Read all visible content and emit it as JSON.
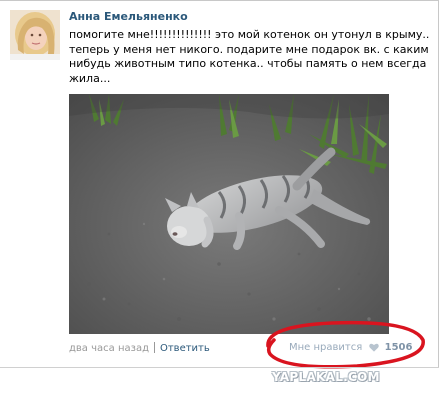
{
  "post": {
    "author": "Анна Емельяненко",
    "text_lines": [
      "помогите мне!!!!!!!!!!!!!! это мой котенок он утонул в крыму..",
      "теперь у меня нет никого. подарите мне подарок вк. с каким",
      "нибудь животным типо котенка.. чтобы память о нем всегда",
      "жила..."
    ],
    "timestamp": "два часа назад",
    "reply_label": "Ответить",
    "like_label": "Мне нравится",
    "like_count": "1506"
  },
  "watermark": "YAPLAKAL.COM",
  "colors": {
    "link": "#2b587a",
    "meta": "#999999",
    "like": "#99aabb",
    "highlight": "#d9141f"
  },
  "icons": {
    "like": "heart-icon"
  }
}
